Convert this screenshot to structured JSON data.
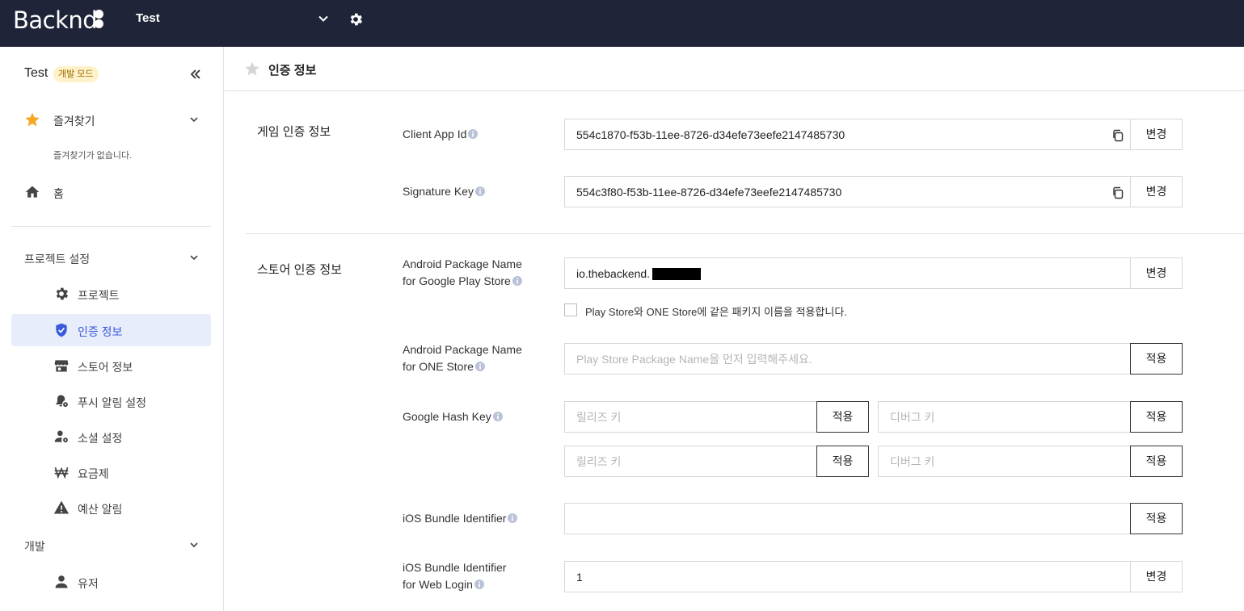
{
  "topbar": {
    "logo_text": "Backnd",
    "project_name": "Test"
  },
  "sidebar": {
    "project_title": "Test",
    "mode_badge": "개발 모드",
    "favorites_label": "즐겨찾기",
    "favorites_empty": "즐겨찾기가 없습니다.",
    "home_label": "홈",
    "project_settings_label": "프로젝트 설정",
    "items": [
      {
        "label": "프로젝트",
        "icon": "gear-icon"
      },
      {
        "label": "인증 정보",
        "icon": "shield-icon",
        "active": true
      },
      {
        "label": "스토어 정보",
        "icon": "store-icon"
      },
      {
        "label": "푸시 알림 설정",
        "icon": "bell-gear-icon"
      },
      {
        "label": "소셜 설정",
        "icon": "user-gear-icon"
      },
      {
        "label": "요금제",
        "icon": "won-icon"
      },
      {
        "label": "예산 알림",
        "icon": "warning-icon"
      }
    ],
    "dev_label": "개발",
    "dev_items": [
      {
        "label": "유저",
        "icon": "user-icon"
      }
    ]
  },
  "header": {
    "title": "인증 정보"
  },
  "game_auth": {
    "section_title": "게임 인증 정보",
    "client_app_id_label": "Client App Id",
    "client_app_id_value": "554c1870-f53b-11ee-8726-d34efe73eefe2147485730",
    "signature_key_label": "Signature Key",
    "signature_key_value": "554c3f80-f53b-11ee-8726-d34efe73eefe2147485730",
    "change_label": "변경"
  },
  "store_auth": {
    "section_title": "스토어 인증 정보",
    "android_google_label_1": "Android Package Name",
    "android_google_label_2": "for Google Play Store",
    "android_google_value": "io.thebackend.",
    "same_package_checkbox_label": "Play Store와 ONE Store에 같은 패키지 이름을 적용합니다.",
    "android_one_label_1": "Android Package Name",
    "android_one_label_2": "for ONE Store",
    "android_one_placeholder": "Play Store Package Name을 먼저 입력해주세요.",
    "google_hash_label": "Google Hash Key",
    "release_key_placeholder": "릴리즈 키",
    "debug_key_placeholder": "디버그 키",
    "ios_bundle_label": "iOS Bundle Identifier",
    "ios_bundle_value": "",
    "ios_web_label_1": "iOS Bundle Identifier",
    "ios_web_label_2": "for Web Login",
    "ios_web_value": "1",
    "change_label": "변경",
    "apply_label": "적용"
  },
  "colors": {
    "topbar_bg": "#1f2438",
    "accent": "#3a5bd9",
    "favorite_star": "#f5a623",
    "badge_bg": "#fff1c9"
  }
}
